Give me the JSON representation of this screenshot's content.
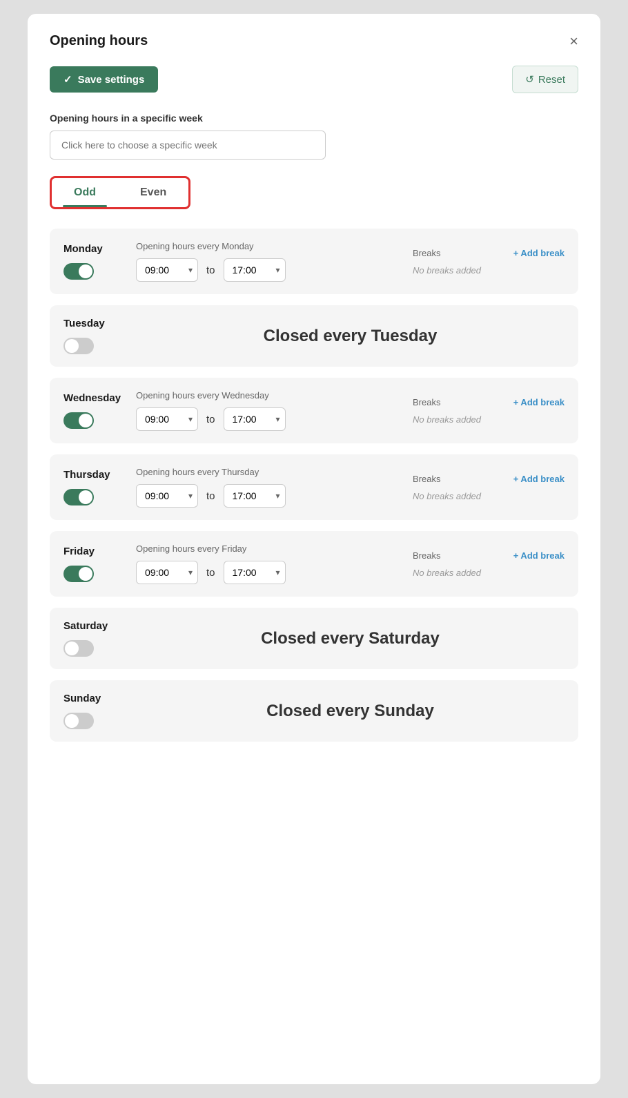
{
  "modal": {
    "title": "Opening hours",
    "close_label": "×"
  },
  "toolbar": {
    "save_label": "Save settings",
    "save_icon": "✓",
    "reset_label": "Reset",
    "reset_icon": "↺"
  },
  "specific_week": {
    "label": "Opening hours in a specific week",
    "placeholder": "Click here to choose a specific week"
  },
  "tabs": [
    {
      "id": "odd",
      "label": "Odd",
      "active": true
    },
    {
      "id": "even",
      "label": "Even",
      "active": false
    }
  ],
  "days": [
    {
      "name": "Monday",
      "toggle": true,
      "sub_label": "Opening hours every Monday",
      "open_time": "09:00",
      "close_time": "17:00",
      "breaks_label": "Breaks",
      "add_break": "+ Add break",
      "no_breaks": "No breaks added",
      "closed": false
    },
    {
      "name": "Tuesday",
      "toggle": false,
      "closed": true,
      "closed_msg": "Closed every Tuesday"
    },
    {
      "name": "Wednesday",
      "toggle": true,
      "sub_label": "Opening hours every Wednesday",
      "open_time": "09:00",
      "close_time": "17:00",
      "breaks_label": "Breaks",
      "add_break": "+ Add break",
      "no_breaks": "No breaks added",
      "closed": false
    },
    {
      "name": "Thursday",
      "toggle": true,
      "sub_label": "Opening hours every Thursday",
      "open_time": "09:00",
      "close_time": "17:00",
      "breaks_label": "Breaks",
      "add_break": "+ Add break",
      "no_breaks": "No breaks added",
      "closed": false
    },
    {
      "name": "Friday",
      "toggle": true,
      "sub_label": "Opening hours every Friday",
      "open_time": "09:00",
      "close_time": "17:00",
      "breaks_label": "Breaks",
      "add_break": "+ Add break",
      "no_breaks": "No breaks added",
      "closed": false
    },
    {
      "name": "Saturday",
      "toggle": false,
      "closed": true,
      "closed_msg": "Closed every Saturday"
    },
    {
      "name": "Sunday",
      "toggle": false,
      "closed": true,
      "closed_msg": "Closed every Sunday"
    }
  ],
  "to_label": "to",
  "colors": {
    "green": "#3a7a5c",
    "red_border": "#e03030",
    "blue_link": "#3a8fc7"
  }
}
